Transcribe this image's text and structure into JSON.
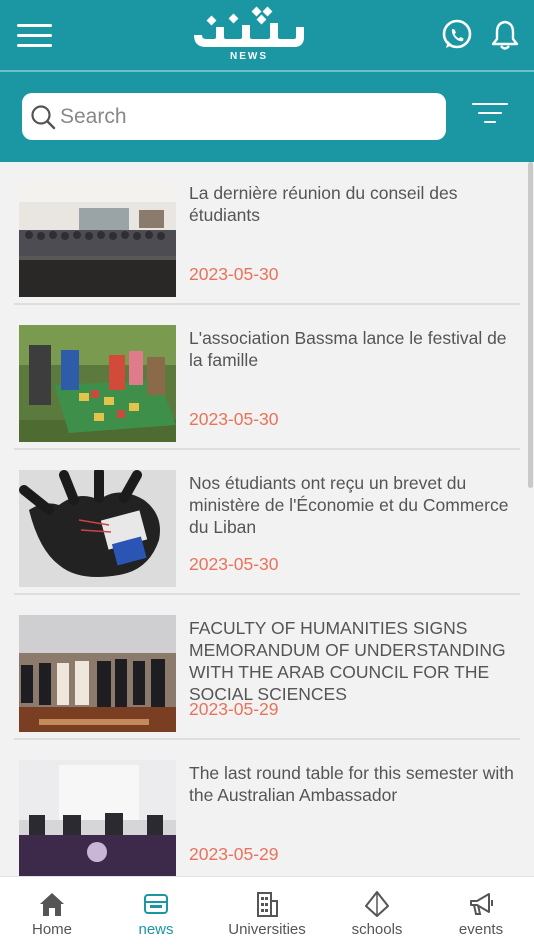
{
  "header": {
    "logo_text": "شباب",
    "logo_subtitle": "NEWS"
  },
  "search": {
    "placeholder": "Search"
  },
  "articles": [
    {
      "title": "La dernière réunion du conseil des étudiants",
      "date": "2023-05-30"
    },
    {
      "title": "L'association Bassma lance le festival de la famille",
      "date": "2023-05-30"
    },
    {
      "title": "Nos étudiants ont reçu un brevet du ministère de l'Économie et du Commerce du Liban",
      "date": "2023-05-30"
    },
    {
      "title": "FACULTY OF HUMANITIES SIGNS MEMORANDUM OF UNDERSTANDING WITH THE ARAB COUNCIL FOR THE SOCIAL SCIENCES",
      "date": "2023-05-29"
    },
    {
      "title": "The last round table for this semester with the Australian Ambassador",
      "date": "2023-05-29"
    }
  ],
  "tabs": [
    {
      "label": "Home",
      "icon": "home-icon"
    },
    {
      "label": "news",
      "icon": "news-icon"
    },
    {
      "label": "Universities",
      "icon": "building-icon"
    },
    {
      "label": "schools",
      "icon": "diamond-icon"
    },
    {
      "label": "events",
      "icon": "megaphone-icon"
    }
  ],
  "active_tab": "news",
  "colors": {
    "primary": "#1b97a3",
    "date": "#e8735a",
    "text": "#555555"
  }
}
